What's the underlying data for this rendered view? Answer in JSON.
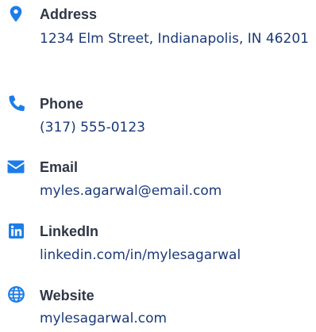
{
  "colors": {
    "icon": "#1d7de8",
    "label": "#2f3645",
    "value": "#1a3a78"
  },
  "contacts": [
    {
      "icon": "map-pin-icon",
      "label": "Address",
      "value": "1234 Elm Street, Indianapolis, IN 46201"
    },
    {
      "icon": "phone-icon",
      "label": "Phone",
      "value": "(317) 555-0123"
    },
    {
      "icon": "envelope-icon",
      "label": "Email",
      "value": "myles.agarwal@email.com"
    },
    {
      "icon": "linkedin-icon",
      "label": "LinkedIn",
      "value": "linkedin.com/in/mylesagarwal"
    },
    {
      "icon": "globe-icon",
      "label": "Website",
      "value": "mylesagarwal.com"
    }
  ]
}
